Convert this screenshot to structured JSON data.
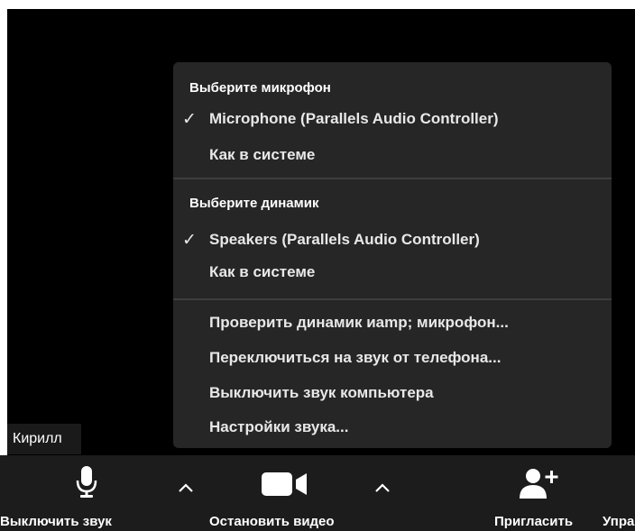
{
  "participant": {
    "name": "Кирилл"
  },
  "audio_menu": {
    "microphone_header": "Выберите микрофон",
    "microphone_items": [
      {
        "label": "Microphone (Parallels Audio Controller)",
        "checked": true
      },
      {
        "label": "Как в системе",
        "checked": false
      }
    ],
    "speaker_header": "Выберите динамик",
    "speaker_items": [
      {
        "label": "Speakers (Parallels Audio Controller)",
        "checked": true
      },
      {
        "label": "Как в системе",
        "checked": false
      }
    ],
    "actions": [
      "Проверить динамик иamp; микрофон...",
      "Переключиться на звук от телефона...",
      "Выключить звук компьютера",
      "Настройки звука..."
    ],
    "check_glyph": "✓"
  },
  "toolbar": {
    "mute_label": "Выключить звук",
    "stop_video_label": "Остановить видео",
    "invite_label": "Пригласить",
    "manage_label": "Упра"
  },
  "icons": {
    "microphone": "microphone-icon",
    "video": "video-camera-icon",
    "invite": "add-person-icon",
    "caret": "chevron-up-icon"
  },
  "colors": {
    "menu_bg": "#262626",
    "toolbar_bg": "#1c1c1c",
    "video_bg": "#000000"
  }
}
